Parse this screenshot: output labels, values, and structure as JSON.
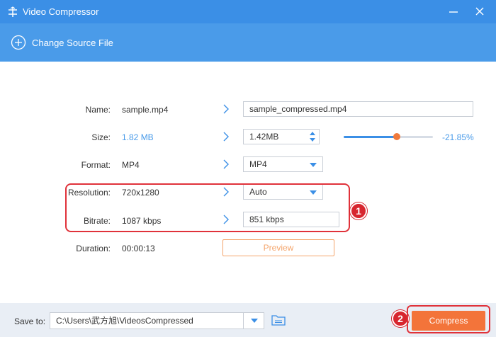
{
  "window": {
    "title": "Video Compressor"
  },
  "toolbar": {
    "change_source_label": "Change Source File"
  },
  "rows": {
    "name": {
      "label": "Name:",
      "source": "sample.mp4",
      "output": "sample_compressed.mp4"
    },
    "size": {
      "label": "Size:",
      "source": "1.82 MB",
      "output": "1.42MB",
      "percent": "-21.85%",
      "slider_fraction": 0.58
    },
    "format": {
      "label": "Format:",
      "source": "MP4",
      "output": "MP4"
    },
    "resolution": {
      "label": "Resolution:",
      "source": "720x1280",
      "output": "Auto"
    },
    "bitrate": {
      "label": "Bitrate:",
      "source": "1087 kbps",
      "output": "851 kbps"
    },
    "duration": {
      "label": "Duration:",
      "source": "00:00:13"
    }
  },
  "preview_label": "Preview",
  "badges": {
    "one": "1",
    "two": "2"
  },
  "footer": {
    "save_to_label": "Save to:",
    "path": "C:\\Users\\武方旭\\VideosCompressed",
    "compress_label": "Compress"
  },
  "colors": {
    "titlebar": "#3b8fe6",
    "toolbar": "#4a9be9",
    "accent_orange": "#f3743a",
    "highlight_red": "#e0323a"
  },
  "icons": [
    "app-icon",
    "minimize-icon",
    "close-icon",
    "add-circle-icon",
    "chevron-right-icon",
    "dropdown-icon",
    "stepper-icon",
    "folder-icon"
  ]
}
